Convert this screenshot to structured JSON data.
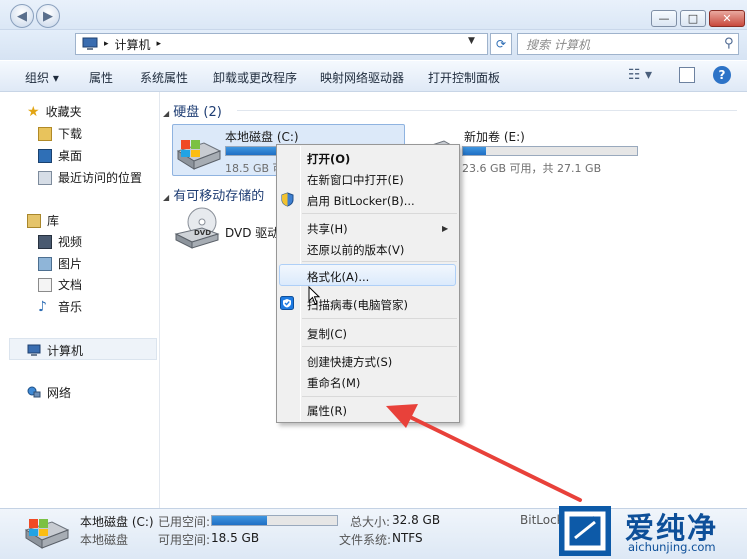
{
  "window": {
    "minimize_glyph": "—",
    "maximize_glyph": "□",
    "close_glyph": "✕"
  },
  "navigation": {
    "back_glyph": "◀",
    "forward_glyph": "▶",
    "breadcrumb": [
      "计算机"
    ],
    "search_placeholder": "搜索 计算机"
  },
  "toolbar": {
    "items": [
      "组织 ▾",
      "属性",
      "系统属性",
      "卸载或更改程序",
      "映射网络驱动器",
      "打开控制面板"
    ],
    "help_label": "?"
  },
  "sidebar": {
    "favorites_label": "收藏夹",
    "favorites": [
      "下载",
      "桌面",
      "最近访问的位置"
    ],
    "libraries_label": "库",
    "libraries": [
      "视频",
      "图片",
      "文档",
      "音乐"
    ],
    "computer_label": "计算机",
    "network_label": "网络"
  },
  "main": {
    "hard_disks_header": "硬盘 (2)",
    "removable_header": "有可移动存储的",
    "drive_c": {
      "label": "本地磁盘 (C:)",
      "free_text": "18.5 GB 可",
      "used_fraction": 0.44
    },
    "drive_e": {
      "label": "新加卷 (E:)",
      "free_text": "23.6 GB 可用，共 27.1 GB",
      "used_fraction": 0.13
    },
    "dvd_label": "DVD 驱动"
  },
  "context_menu": {
    "items": [
      {
        "label": "打开(O)",
        "bold": true
      },
      {
        "label": "在新窗口中打开(E)"
      },
      {
        "label": "启用 BitLocker(B)..."
      },
      {
        "label": "共享(H)"
      },
      {
        "label": "还原以前的版本(V)"
      },
      {
        "label": "格式化(A)..."
      },
      {
        "label": "扫描病毒(电脑管家)"
      },
      {
        "label": "复制(C)"
      },
      {
        "label": "创建快捷方式(S)"
      },
      {
        "label": "重命名(M)"
      },
      {
        "label": "属性(R)"
      }
    ]
  },
  "details": {
    "drive_name": "本地磁盘 (C:)",
    "drive_type": "本地磁盘",
    "used_label": "已用空间:",
    "free_label": "可用空间:",
    "free_value": "18.5 GB",
    "total_label": "总大小:",
    "total_value": "32.8 GB",
    "fs_label": "文件系统:",
    "fs_value": "NTFS",
    "bitlocker_text": "BitLock",
    "used_fraction": 0.44
  },
  "watermark": {
    "brand": "爱纯净",
    "url": "aichunjing.com"
  },
  "colors": {
    "annotation_arrow": "#e8413a",
    "selection": "#dce9f9",
    "brand_blue": "#0d5aa8"
  }
}
